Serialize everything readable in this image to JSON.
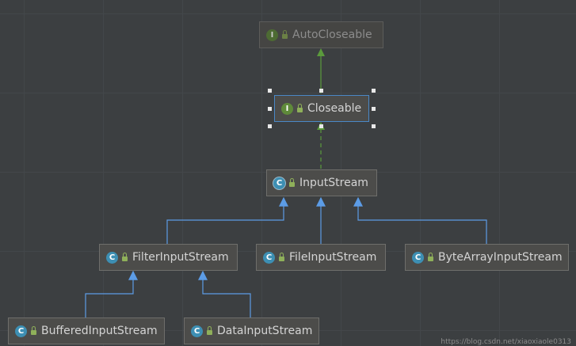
{
  "colors": {
    "background": "#3c3f41",
    "node_fill": "#4c4c4a",
    "selection_border": "#4a88c7",
    "implements_arrow": "#5b9a3c",
    "extends_arrow": "#5c9ce6"
  },
  "nodes": {
    "autocloseable": {
      "name": "AutoCloseable",
      "kind": "interface",
      "badge": "I",
      "icon": "interface-icon"
    },
    "closeable": {
      "name": "Closeable",
      "kind": "interface",
      "badge": "I",
      "icon": "interface-icon"
    },
    "inputstream": {
      "name": "InputStream",
      "kind": "abstract-class",
      "badge": "C",
      "icon": "abstract-class-icon"
    },
    "filterinputstream": {
      "name": "FilterInputStream",
      "kind": "class",
      "badge": "C",
      "icon": "class-icon"
    },
    "fileinputstream": {
      "name": "FileInputStream",
      "kind": "class",
      "badge": "C",
      "icon": "class-icon"
    },
    "bytearrayinputstream": {
      "name": "ByteArrayInputStream",
      "kind": "class",
      "badge": "C",
      "icon": "class-icon"
    },
    "bufferedinputstream": {
      "name": "BufferedInputStream",
      "kind": "class",
      "badge": "C",
      "icon": "class-icon"
    },
    "datainputstream": {
      "name": "DataInputStream",
      "kind": "class",
      "badge": "C",
      "icon": "class-icon"
    }
  },
  "edges": [
    {
      "from": "closeable",
      "to": "autocloseable",
      "type": "extends-interface"
    },
    {
      "from": "inputstream",
      "to": "closeable",
      "type": "implements"
    },
    {
      "from": "filterinputstream",
      "to": "inputstream",
      "type": "extends"
    },
    {
      "from": "fileinputstream",
      "to": "inputstream",
      "type": "extends"
    },
    {
      "from": "bytearrayinputstream",
      "to": "inputstream",
      "type": "extends"
    },
    {
      "from": "bufferedinputstream",
      "to": "filterinputstream",
      "type": "extends"
    },
    {
      "from": "datainputstream",
      "to": "filterinputstream",
      "type": "extends"
    }
  ],
  "selected": "closeable",
  "watermark": "https://blog.csdn.net/xiaoxiaole0313"
}
